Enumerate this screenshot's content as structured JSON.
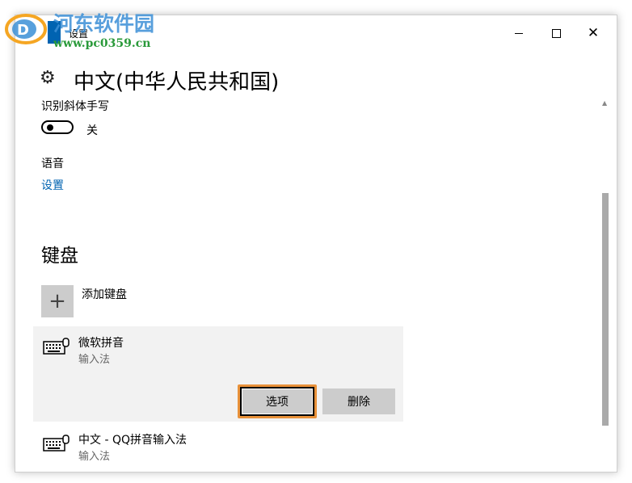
{
  "window": {
    "title": "设置",
    "controls": {
      "minimize": "minimize",
      "maximize": "maximize",
      "close": "✕"
    }
  },
  "page": {
    "title": "中文(中华人民共和国)",
    "handwriting": {
      "label": "识别斜体手写",
      "toggle_state": "关",
      "on": false
    },
    "speech": {
      "label": "语音",
      "link": "设置"
    },
    "keyboard": {
      "heading": "键盘",
      "add_label": "添加键盘",
      "items": [
        {
          "name": "微软拼音",
          "type": "输入法",
          "selected": true
        },
        {
          "name": "中文 - QQ拼音输入法",
          "type": "输入法",
          "selected": false
        }
      ],
      "options_button": "选项",
      "delete_button": "删除"
    }
  },
  "watermark": {
    "brand": "河东软件园",
    "url": "www.pc0359.cn"
  },
  "colors": {
    "accent": "#0063b1",
    "highlight": "#e8913a",
    "button_bg": "#cccccc",
    "card_bg": "#f2f2f2"
  }
}
